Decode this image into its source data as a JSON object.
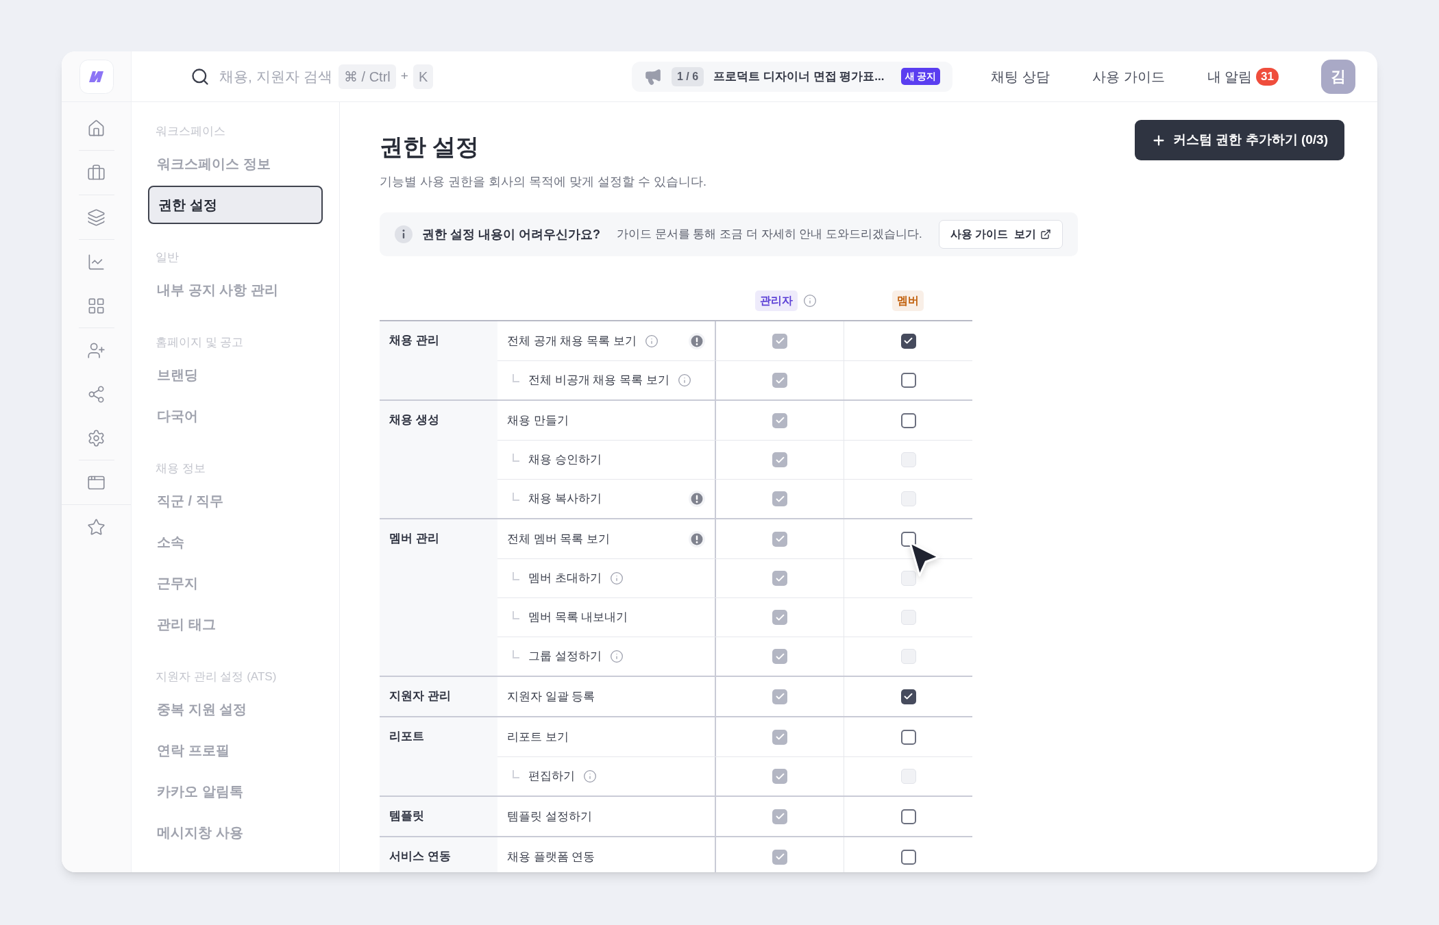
{
  "topbar": {
    "search": {
      "placeholder": "채용, 지원자 검색",
      "shortcut": [
        "⌘ / Ctrl",
        "+",
        "K"
      ]
    },
    "notice": {
      "counter": "1 / 6",
      "text": "프로덕트 디자이너 면접 평가표...",
      "badge": "새 공지"
    },
    "links": [
      {
        "label": "채팅 상담"
      },
      {
        "label": "사용 가이드"
      },
      {
        "label": "내 알림",
        "badge": "31"
      }
    ],
    "avatar": "김"
  },
  "rail": [
    [
      {
        "kind": "home"
      }
    ],
    [
      {
        "kind": "briefcase"
      }
    ],
    [
      {
        "kind": "layers"
      }
    ],
    [
      {
        "kind": "chart"
      },
      {
        "kind": "grid"
      }
    ],
    [
      {
        "kind": "user-plus"
      },
      {
        "kind": "share"
      },
      {
        "kind": "settings"
      }
    ],
    [
      {
        "kind": "window"
      }
    ],
    [
      {
        "kind": "star"
      }
    ]
  ],
  "sidebar": [
    {
      "title": "워크스페이스",
      "items": [
        {
          "label": "워크스페이스 정보",
          "selected": false
        },
        {
          "label": "권한 설정",
          "selected": true
        }
      ]
    },
    {
      "title": "일반",
      "items": [
        {
          "label": "내부 공지 사항 관리",
          "selected": false
        }
      ]
    },
    {
      "title": "홈페이지 및 공고",
      "items": [
        {
          "label": "브랜딩",
          "selected": false
        },
        {
          "label": "다국어",
          "selected": false
        }
      ]
    },
    {
      "title": "채용 정보",
      "items": [
        {
          "label": "직군 / 직무",
          "selected": false
        },
        {
          "label": "소속",
          "selected": false
        },
        {
          "label": "근무지",
          "selected": false
        },
        {
          "label": "관리 태그",
          "selected": false
        }
      ]
    },
    {
      "title": "지원자 관리 설정 (ATS)",
      "items": [
        {
          "label": "중복 지원 설정",
          "selected": false
        },
        {
          "label": "연락 프로필",
          "selected": false
        },
        {
          "label": "카카오 알림톡",
          "selected": false
        },
        {
          "label": "메시지창 사용",
          "selected": false
        }
      ]
    }
  ],
  "page": {
    "title": "권한 설정",
    "subtitle": "기능별 사용 권한을 회사의 목적에 맞게 설정할 수 있습니다.",
    "add_button": "커스텀 권한 추가하기 (0/3)",
    "banner": {
      "title": "권한 설정 내용이 어려우신가요?",
      "text": "가이드 문서를 통해 조금 더 자세히 안내 도와드리겠습니다.",
      "button": "사용 가이드  보기"
    }
  },
  "table": {
    "columns": [
      {
        "label": "관리자",
        "color": "#5b3fd6",
        "info": true
      },
      {
        "label": "멤버",
        "color": "#c2620f",
        "info": false
      }
    ],
    "groups": [
      {
        "name": "채용 관리",
        "permissions": [
          {
            "label": "전체 공개 채용 목록 보기",
            "info": true,
            "warning": true,
            "admin": {
              "checked": true,
              "disabled": true
            },
            "member": {
              "checked": true,
              "disabled": false
            },
            "children": [
              {
                "label": "전체 비공개 채용 목록 보기",
                "info": true,
                "warning": false,
                "admin": {
                  "checked": true,
                  "disabled": true
                },
                "member": {
                  "checked": false,
                  "disabled": false
                }
              }
            ]
          }
        ]
      },
      {
        "name": "채용 생성",
        "permissions": [
          {
            "label": "채용 만들기",
            "info": false,
            "warning": false,
            "admin": {
              "checked": true,
              "disabled": true
            },
            "member": {
              "checked": false,
              "disabled": false
            },
            "children": [
              {
                "label": "채용 승인하기",
                "info": false,
                "warning": false,
                "admin": {
                  "checked": true,
                  "disabled": true
                },
                "member": {
                  "checked": false,
                  "disabled": true
                }
              },
              {
                "label": "채용 복사하기",
                "info": false,
                "warning": true,
                "admin": {
                  "checked": true,
                  "disabled": true
                },
                "member": {
                  "checked": false,
                  "disabled": true
                }
              }
            ]
          }
        ]
      },
      {
        "name": "멤버 관리",
        "permissions": [
          {
            "label": "전체 멤버 목록 보기",
            "info": false,
            "warning": true,
            "admin": {
              "checked": true,
              "disabled": true
            },
            "member": {
              "checked": false,
              "disabled": false
            },
            "children": [
              {
                "label": "멤버 초대하기",
                "info": true,
                "warning": false,
                "admin": {
                  "checked": true,
                  "disabled": true
                },
                "member": {
                  "checked": false,
                  "disabled": true
                }
              },
              {
                "label": "멤버 목록 내보내기",
                "info": false,
                "warning": false,
                "admin": {
                  "checked": true,
                  "disabled": true
                },
                "member": {
                  "checked": false,
                  "disabled": true
                }
              },
              {
                "label": "그룹 설정하기",
                "info": true,
                "warning": false,
                "admin": {
                  "checked": true,
                  "disabled": true
                },
                "member": {
                  "checked": false,
                  "disabled": true
                }
              }
            ]
          }
        ]
      },
      {
        "name": "지원자 관리",
        "permissions": [
          {
            "label": "지원자 일괄 등록",
            "info": false,
            "warning": false,
            "admin": {
              "checked": true,
              "disabled": true
            },
            "member": {
              "checked": true,
              "disabled": false
            }
          }
        ]
      },
      {
        "name": "리포트",
        "permissions": [
          {
            "label": "리포트 보기",
            "info": false,
            "warning": false,
            "admin": {
              "checked": true,
              "disabled": true
            },
            "member": {
              "checked": false,
              "disabled": false
            },
            "children": [
              {
                "label": "편집하기",
                "info": true,
                "warning": false,
                "admin": {
                  "checked": true,
                  "disabled": true
                },
                "member": {
                  "checked": false,
                  "disabled": true
                }
              }
            ]
          }
        ]
      },
      {
        "name": "템플릿",
        "permissions": [
          {
            "label": "템플릿 설정하기",
            "info": false,
            "warning": false,
            "admin": {
              "checked": true,
              "disabled": true
            },
            "member": {
              "checked": false,
              "disabled": false
            }
          }
        ]
      },
      {
        "name": "서비스 연동",
        "permissions": [
          {
            "label": "채용 플랫폼 연동",
            "info": false,
            "warning": false,
            "admin": {
              "checked": true,
              "disabled": true
            },
            "member": {
              "checked": false,
              "disabled": false
            }
          }
        ]
      }
    ]
  }
}
